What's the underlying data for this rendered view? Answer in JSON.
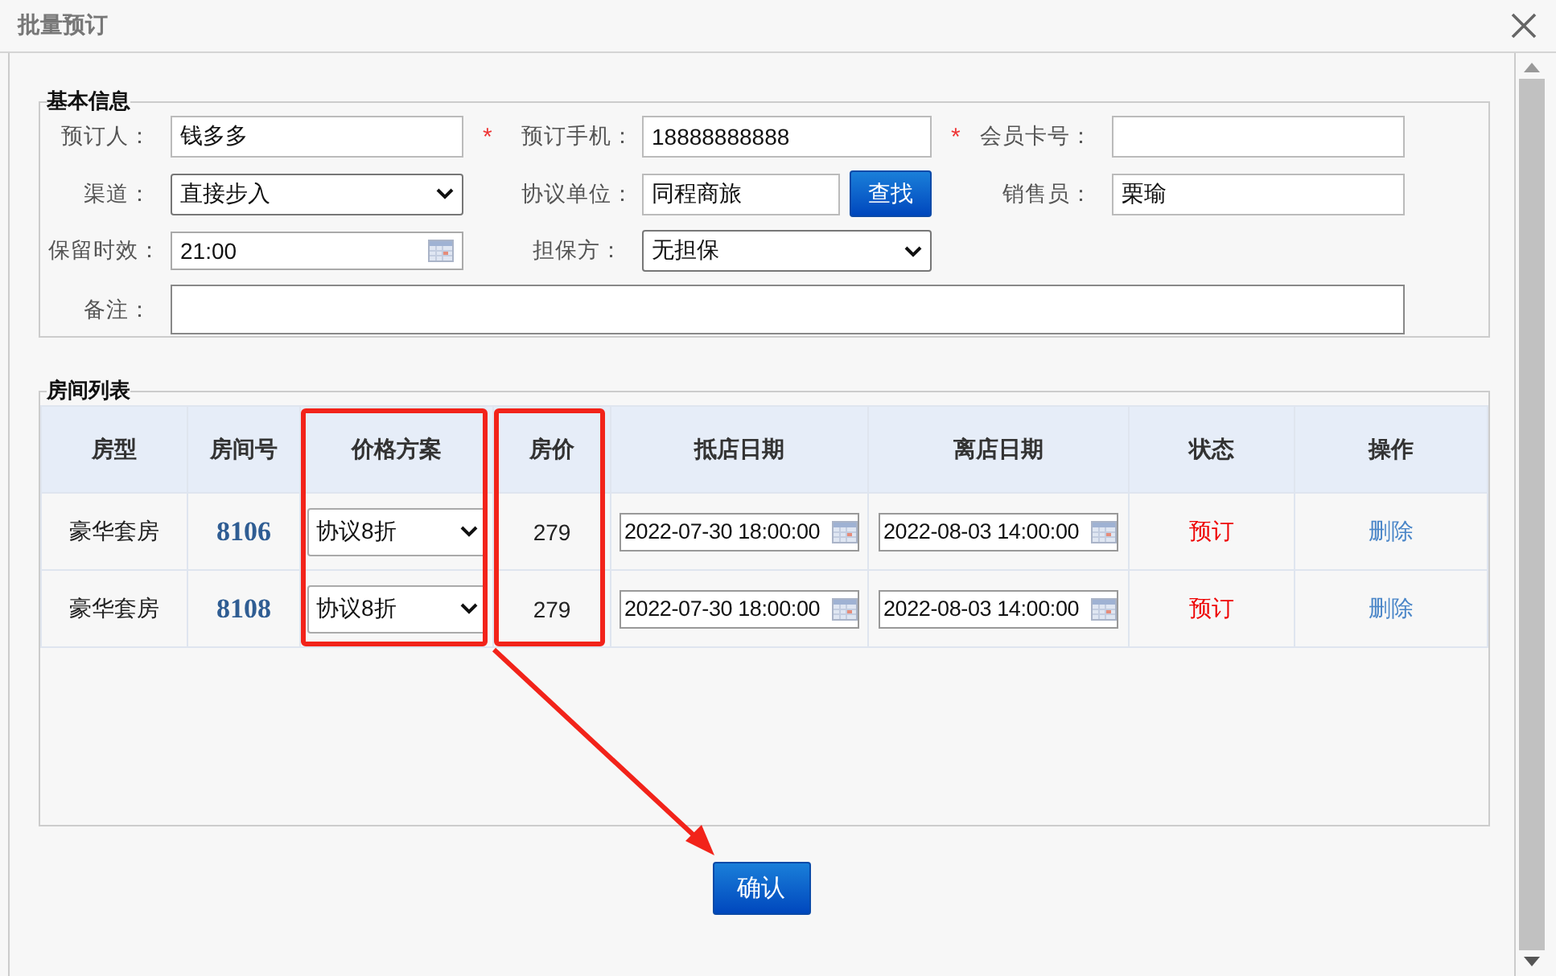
{
  "dialog": {
    "title": "批量预订"
  },
  "basic_info": {
    "legend": "基本信息",
    "fields": [
      {
        "label": "预订人：",
        "kind": "text",
        "value": "钱多多",
        "mark": "*"
      },
      {
        "label": "预订手机：",
        "kind": "text",
        "value": "18888888888",
        "mark": "*"
      },
      {
        "label": "会员卡号：",
        "kind": "text"
      },
      {
        "label": "渠道：",
        "kind": "select",
        "value": "直接步入"
      },
      {
        "label": "协议单位：",
        "kind": "search",
        "value": "同程商旅",
        "button": "查找"
      },
      {
        "label": "销售员：",
        "kind": "text",
        "value": "栗瑜"
      },
      {
        "label": "保留时效：",
        "kind": "date",
        "value": "21:00"
      },
      {
        "label": "担保方：",
        "kind": "select",
        "value": "无担保"
      },
      {
        "label": "备注：",
        "kind": "textarea"
      }
    ]
  },
  "room_list": {
    "legend": "房间列表",
    "columns": [
      {
        "label": "房型",
        "highlighted": false
      },
      {
        "label": "房间号",
        "highlighted": false
      },
      {
        "label": "价格方案",
        "highlighted": true
      },
      {
        "label": "房价",
        "highlighted": true
      },
      {
        "label": "抵店日期",
        "highlighted": false
      },
      {
        "label": "离店日期",
        "highlighted": false
      },
      {
        "label": "状态",
        "highlighted": false
      },
      {
        "label": "操作",
        "highlighted": false
      }
    ],
    "rows": [
      {
        "room_type": "豪华套房",
        "room_no": "8106",
        "price_plan": "协议8折",
        "price": "279",
        "arrival": "2022-07-30 18:00:00",
        "departure": "2022-08-03 14:00:00",
        "status": "预订",
        "action": "删除"
      },
      {
        "room_type": "豪华套房",
        "room_no": "8108",
        "price_plan": "协议8折",
        "price": "279",
        "arrival": "2022-07-30 18:00:00",
        "departure": "2022-08-03 14:00:00",
        "status": "预订",
        "action": "删除"
      }
    ]
  },
  "confirm_button": "确认"
}
